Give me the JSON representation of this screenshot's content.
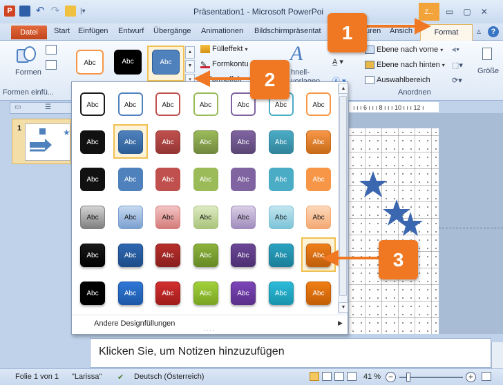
{
  "window": {
    "title": "Präsentation1 - Microsoft PowerPoi",
    "app_icon": "P",
    "context_tab_header": "Z..."
  },
  "tabs": {
    "file": "Datei",
    "items": [
      "Start",
      "Einfügen",
      "Entwurf",
      "Übergänge",
      "Animationen",
      "Bildschirmpräsentat",
      "...uren",
      "Ansich"
    ],
    "format": "Format"
  },
  "ribbon": {
    "shapes_label": "Formen",
    "shapes_group_label": "Formen einfü...",
    "style_thumbs": [
      "Abc",
      "Abc",
      "Abc"
    ],
    "shape_fill": "Fülleffekt",
    "shape_outline": "Formkontu",
    "shape_effects": "Formeffek",
    "quick_styles_line1": "hnell-",
    "quick_styles_line2": "vorlagen",
    "bring_forward": "Ebene nach vorne",
    "send_backward": "Ebene nach hinten",
    "selection_pane": "Auswahlbereich",
    "arrange_group_label": "Anordnen",
    "size_label": "Größe"
  },
  "gallery": {
    "swatch_text": "Abc",
    "rows": [
      [
        "#ffffff|#1a1a1a|#1a1a1a",
        "#ffffff|#4f81bd|#1a1a1a",
        "#ffffff|#c0504d|#1a1a1a",
        "#ffffff|#9bbb59|#1a1a1a",
        "#ffffff|#8064a2|#1a1a1a",
        "#ffffff|#4bacc6|#1a1a1a",
        "#ffffff|#f79646|#1a1a1a"
      ],
      [
        "#111111|#111111|#ffffff",
        "#4f81bd|#2c5d96|#ffffff",
        "#c0504d|#943634|#ffffff",
        "#9bbb59|#71893f|#ffffff",
        "#8064a2|#5c4776|#ffffff",
        "#4bacc6|#31849b|#ffffff",
        "#f79646|#c76c1a|#ffffff"
      ],
      [
        "#111111|#111111|#ffffff",
        "#4f81bd|#4f81bd|#ffffff",
        "#c0504d|#c0504d|#ffffff",
        "#9bbb59|#9bbb59|#ffffff",
        "#8064a2|#8064a2|#ffffff",
        "#4bacc6|#4bacc6|#ffffff",
        "#f79646|#f79646|#ffffff"
      ],
      [
        "#d4d4d4|#7f7f7f|#1a1a1a",
        "#c6d9f1|#7ba0cf|#1a1a1a",
        "#f2c4c3|#d47c7a|#1a1a1a",
        "#deebc3|#a9c47b|#1a1a1a",
        "#d9cfe6|#a08cbd|#1a1a1a",
        "#c3e6f0|#7cc3d8|#1a1a1a",
        "#fcd9bb|#f4a873|#1a1a1a"
      ],
      [
        "#1a1a1a|#000000|#ffffff",
        "#2f67b0|#1e4d8a|#ffffff",
        "#b72f2c|#8b1f1d|#ffffff",
        "#8cb23c|#678a26|#ffffff",
        "#6b4796|#4e3073|#ffffff",
        "#2aa2c0|#1b7f99|#ffffff",
        "#ef7f1a|#c05f0c|#ffffff"
      ],
      [
        "#000000|#000000|#ffffff",
        "#2f77d6|#1c58a8|#ffffff",
        "#d22f2f|#a11c1c|#ffffff",
        "#a2d13a|#7aa423|#ffffff",
        "#7c45b8|#5a2f8a|#ffffff",
        "#2cbbd8|#1994ad|#ffffff",
        "#f07d14|#c45f06|#ffffff"
      ]
    ],
    "selected_cell": "1-1",
    "hover_cell": "4-6",
    "footer_label": "Andere Designfüllungen"
  },
  "slide_pane": {
    "slide_number": "1"
  },
  "ruler": {
    "ticks": "ı ı ı 6 ı ı ı 8 ı ı ı 10 ı ı ı 12 ı"
  },
  "notes": {
    "placeholder": "Klicken Sie, um Notizen hinzuzufügen"
  },
  "statusbar": {
    "slide_info": "Folie 1 von 1",
    "theme": "\"Larissa\"",
    "language": "Deutsch (Österreich)",
    "zoom": "41 %"
  },
  "callouts": [
    "1",
    "2",
    "3"
  ],
  "colors": {
    "accent_orange": "#f07822",
    "selection_gold": "#f0c050",
    "file_tab": "#c2451c"
  },
  "icons": [
    "app-icon",
    "save-icon",
    "undo-icon",
    "redo-icon",
    "open-icon",
    "minimize-icon",
    "maximize-icon",
    "close-icon",
    "help-icon",
    "star-icon",
    "arrow-icon",
    "zoom-in-icon",
    "zoom-out-icon",
    "fit-window-icon",
    "spellcheck-icon"
  ]
}
